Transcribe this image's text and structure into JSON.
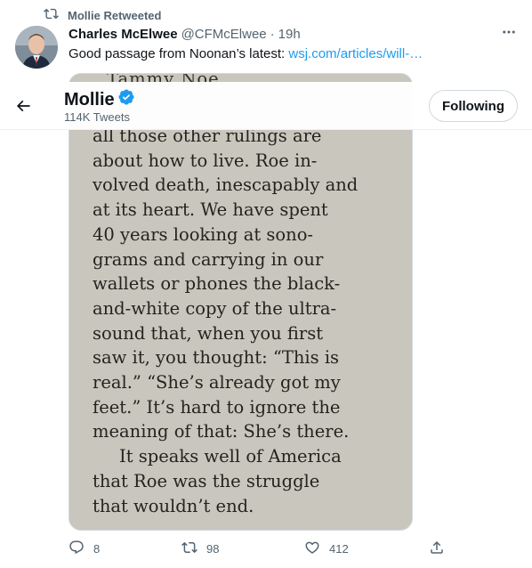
{
  "retweet": {
    "label": "Mollie Retweeted",
    "icon": "retweet-icon"
  },
  "tweet": {
    "author_name": "Charles McElwee",
    "handle": "@CFMcElwee",
    "separator": "·",
    "time": "19h",
    "text": "Good passage from Noonan’s latest: ",
    "link": "wsj.com/articles/will-…",
    "media_cut_text": "Tammy Noe.",
    "media_lines": [
      "all those other rulings are",
      "about how to live. Roe in-",
      "volved death, inescapably and",
      "at its heart. We have spent",
      "40 years looking at sono-",
      "grams and carrying in our",
      "wallets or phones the black-",
      "and-white copy of the ultra-",
      "sound that, when you first",
      "saw it, you thought: “This is",
      "real.” “She’s already got my",
      "feet.” It’s hard to ignore the",
      "meaning of that: She’s there.",
      "It speaks well of America",
      "that Roe was the struggle",
      "that wouldn’t end."
    ]
  },
  "profile_header": {
    "name": "Mollie",
    "tweet_count": "114K Tweets",
    "follow_label": "Following"
  },
  "actions": {
    "reply_count": "8",
    "retweet_count": "98",
    "like_count": "412"
  },
  "colors": {
    "accent": "#1d9bf0",
    "text": "#0f1419",
    "secondary": "#536471"
  }
}
